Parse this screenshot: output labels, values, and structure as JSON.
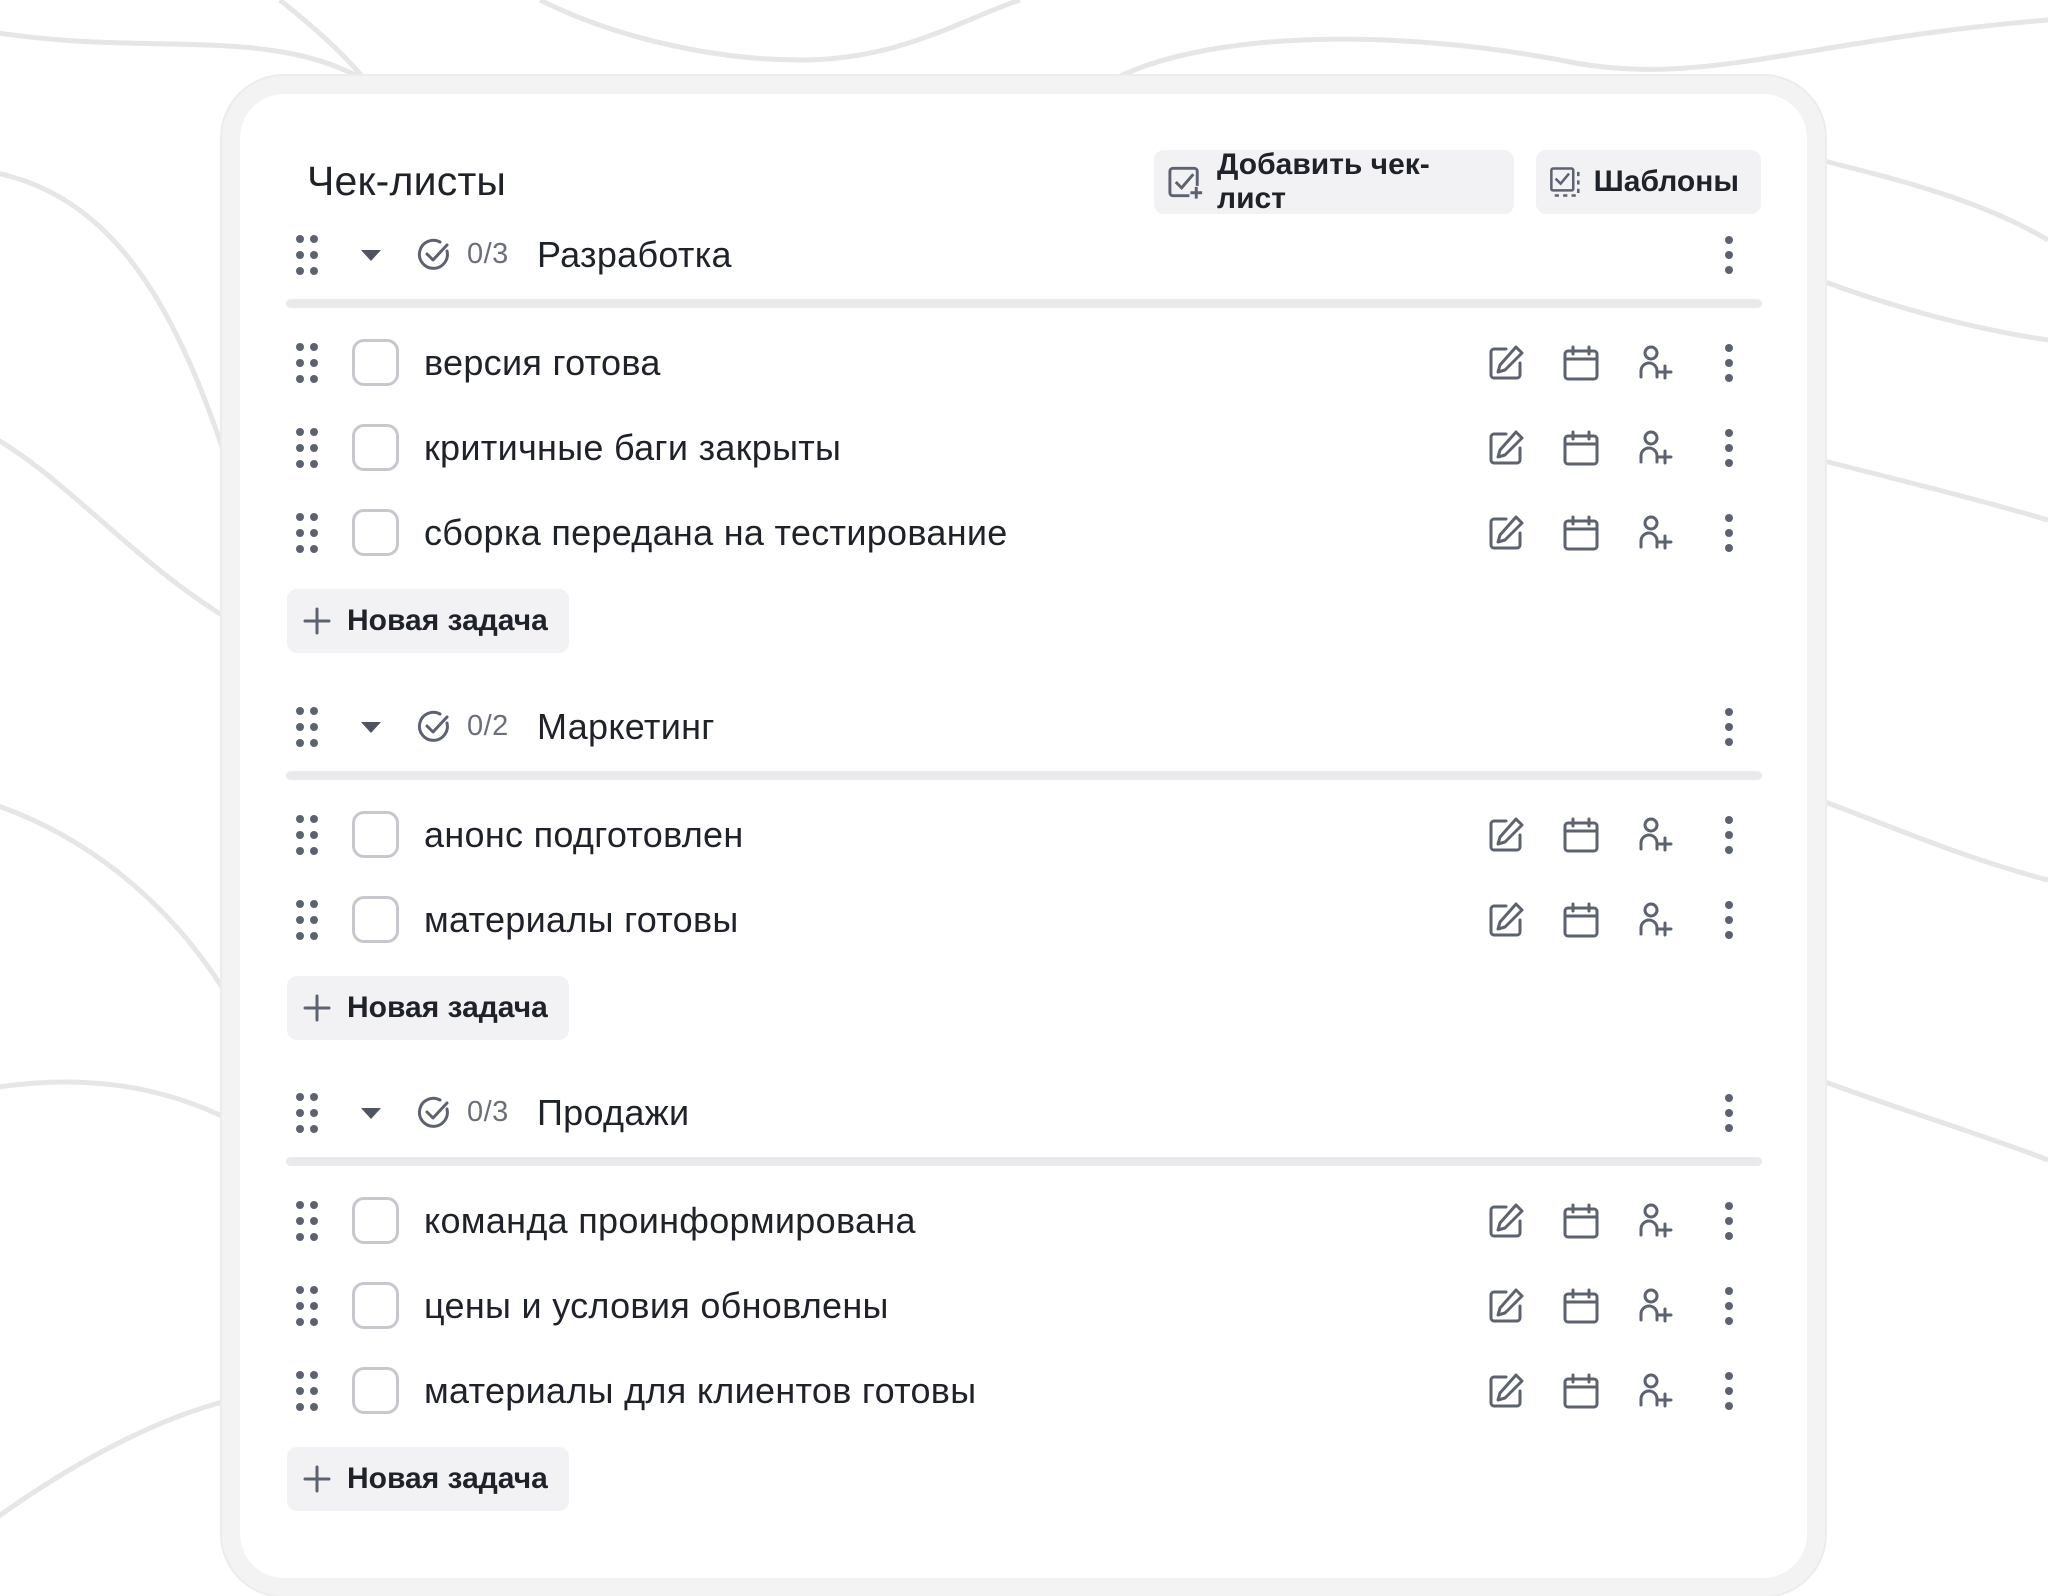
{
  "header": {
    "title": "Чек-листы",
    "add_checklist_label": "Добавить чек-лист",
    "templates_label": "Шаблоны"
  },
  "groups": [
    {
      "name": "Разработка",
      "progress": "0/3",
      "tasks": [
        {
          "label": "версия готова",
          "done": false
        },
        {
          "label": "критичные баги закрыты",
          "done": false
        },
        {
          "label": "сборка передана на тестирование",
          "done": false
        }
      ],
      "new_task_label": "Новая задача"
    },
    {
      "name": "Маркетинг",
      "progress": "0/2",
      "tasks": [
        {
          "label": "анонс подготовлен",
          "done": false
        },
        {
          "label": "материалы готовы",
          "done": false
        }
      ],
      "new_task_label": "Новая задача"
    },
    {
      "name": "Продажи",
      "progress": "0/3",
      "tasks": [
        {
          "label": "команда проинформирована",
          "done": false
        },
        {
          "label": "цены и условия обновлены",
          "done": false
        },
        {
          "label": "материалы для клиентов готовы",
          "done": false
        }
      ],
      "new_task_label": "Новая задача"
    }
  ],
  "icons": {
    "task_actions": [
      "edit-icon",
      "calendar-icon",
      "add-assignee-icon",
      "more-icon"
    ],
    "group_actions": [
      "drag-handle-icon",
      "collapse-caret-icon",
      "progress-check-icon",
      "more-icon"
    ]
  },
  "colors": {
    "icon": "#5d6270",
    "text": "#1f2229",
    "muted": "#6b6f7a",
    "button_bg": "#f2f2f4",
    "checkbox_border": "#c6c8ce",
    "divider": "#eaeaec"
  }
}
